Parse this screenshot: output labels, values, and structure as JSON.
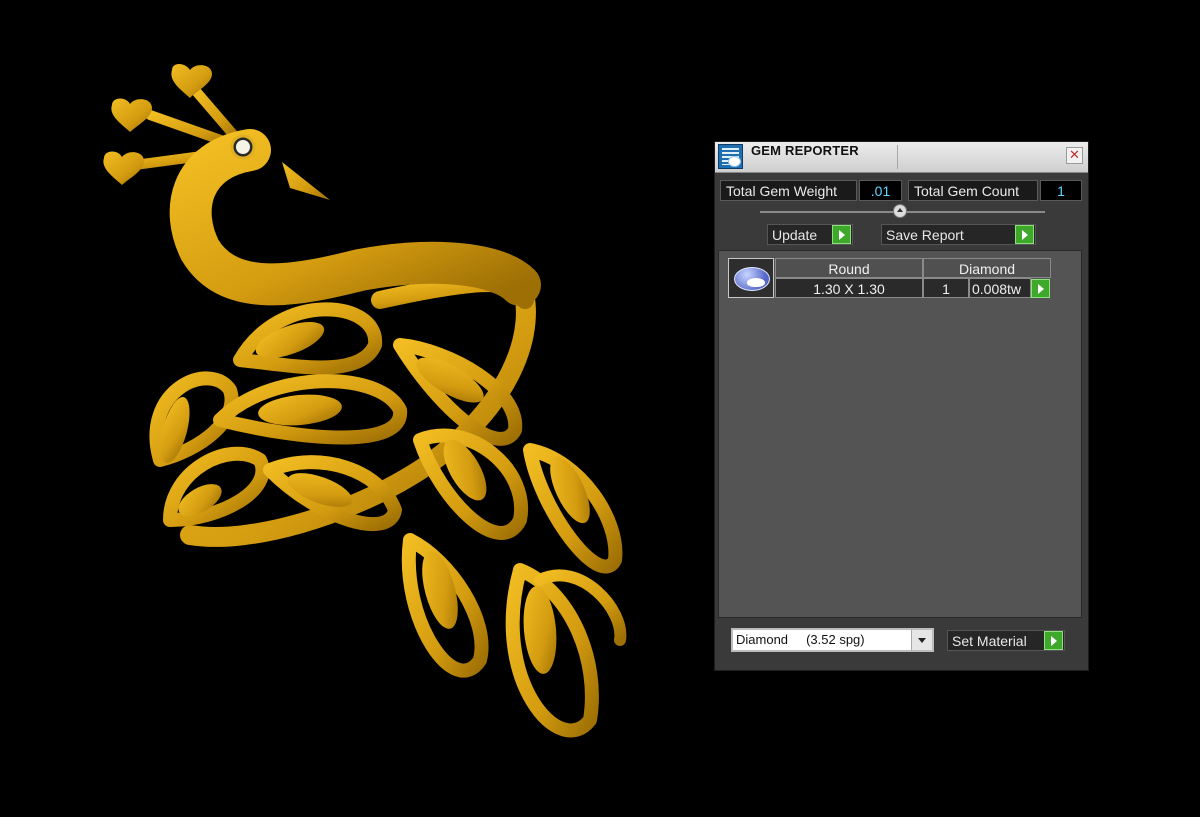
{
  "window": {
    "title": "GEM REPORTER",
    "close_glyph": "✕"
  },
  "stats": {
    "weight_label": "Total Gem Weight",
    "weight_value": ".01",
    "count_label": "Total Gem Count",
    "count_value": "1"
  },
  "buttons": {
    "update": "Update",
    "save_report": "Save Report",
    "set_material": "Set Material"
  },
  "gem_list": [
    {
      "icon": "oval-gem-icon",
      "shape": "Round",
      "material": "Diamond",
      "size": "1.30 X 1.30",
      "count": "1",
      "weight": "0.008tw"
    }
  ],
  "material_select": {
    "value": "Diamond     (3.52 spg)"
  },
  "colors": {
    "gold": "#d9a413",
    "accent_green": "#3ea82a",
    "value_cyan": "#5fd7ff"
  }
}
